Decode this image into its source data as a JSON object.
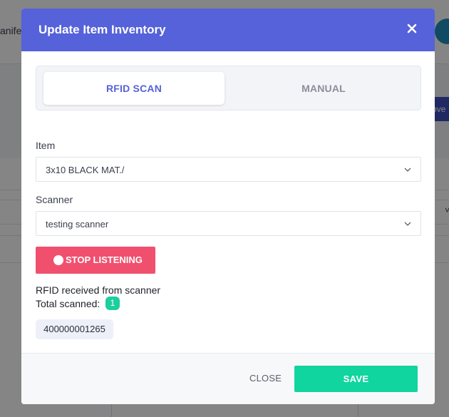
{
  "background": {
    "header_fragment": "anifes",
    "button_fragment": "ove"
  },
  "modal": {
    "title": "Update Item Inventory",
    "close_icon": "close-icon",
    "tabs": [
      {
        "label": "RFID SCAN",
        "active": true
      },
      {
        "label": "MANUAL",
        "active": false
      }
    ],
    "item": {
      "label": "Item",
      "value": "3x10 BLACK MAT./"
    },
    "scanner": {
      "label": "Scanner",
      "value": "testing scanner"
    },
    "stop_button": "STOP LISTENING",
    "received_text": "RFID received from scanner",
    "total_label": "Total scanned:",
    "total_count": "1",
    "rfid_tags": [
      "400000001265"
    ],
    "footer": {
      "close_label": "CLOSE",
      "save_label": "SAVE"
    }
  },
  "colors": {
    "header": "#5562d9",
    "stop": "#f0506e",
    "save": "#10d59e",
    "badge": "#1ccf9e"
  }
}
